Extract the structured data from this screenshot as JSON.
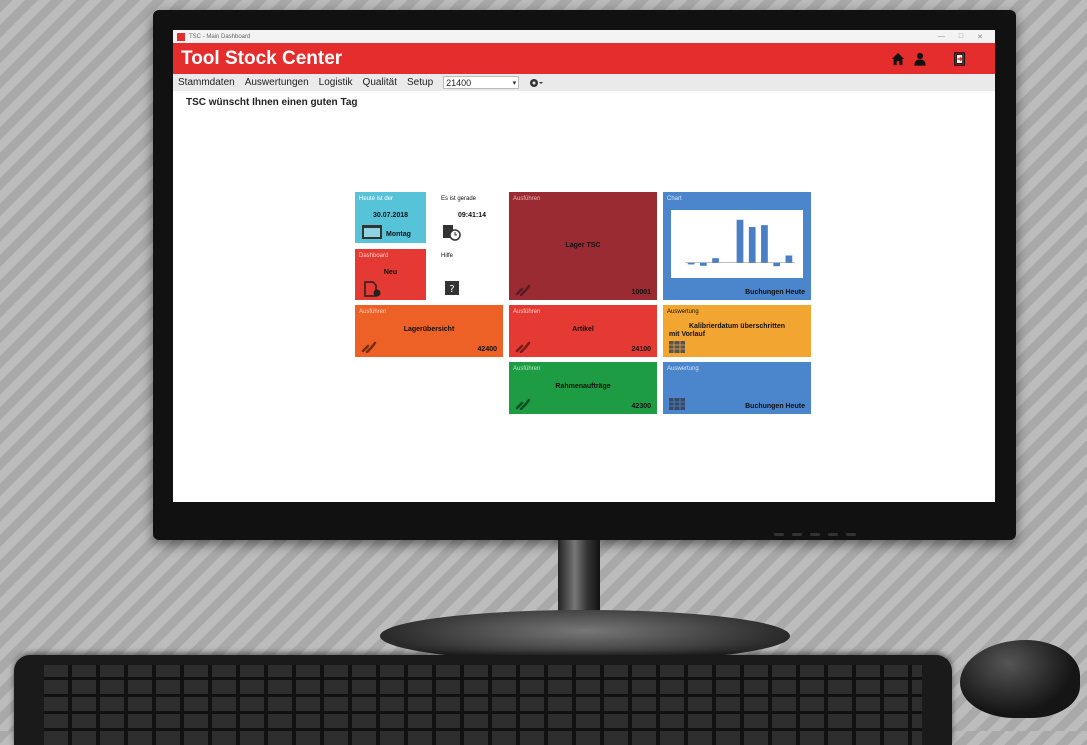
{
  "window": {
    "title": "TSC - Main Dashboard",
    "minimize": "—",
    "maximize": "□",
    "close": "✕"
  },
  "header": {
    "app_title": "Tool Stock Center"
  },
  "menu": {
    "items": [
      "Stammdaten",
      "Auswertungen",
      "Logistik",
      "Qualität",
      "Setup"
    ],
    "combo_value": "21400",
    "combo_arrow": "▾"
  },
  "greeting": "TSC wünscht Ihnen einen guten Tag",
  "tiles": {
    "date": {
      "caption": "Heute ist der",
      "date": "30.07.2018",
      "weekday": "Montag"
    },
    "time": {
      "caption": "Es ist gerade",
      "time": "09:41:14"
    },
    "dashboard": {
      "caption": "Dashboard",
      "main": "Neu"
    },
    "help": {
      "caption": "Hilfe"
    },
    "lager": {
      "caption": "Ausführen",
      "main": "Lager TSC",
      "number": "10001"
    },
    "chart": {
      "caption": "Chart",
      "footer": "Buchungen Heute"
    },
    "lageruebersicht": {
      "caption": "Ausführen",
      "main": "Lagerübersicht",
      "number": "42400"
    },
    "artikel": {
      "caption": "Ausführen",
      "main": "Artikel",
      "number": "24100"
    },
    "kalibrier": {
      "caption": "Auswertung",
      "main_line1": "Kalibrierdatum überschritten",
      "main_line2": "mit Vorlauf"
    },
    "rahmen": {
      "caption": "Ausführen",
      "main": "Rahmenaufträge",
      "number": "42300"
    },
    "buchungen": {
      "caption": "Auswertung",
      "footer": "Buchungen Heute"
    }
  },
  "chart_data": {
    "type": "bar",
    "values": [
      -4,
      -7,
      10,
      0,
      96,
      80,
      84,
      -8,
      16
    ],
    "ylim": [
      -12,
      100
    ]
  },
  "colors": {
    "header_red": "#e52d2d",
    "tile_cyan": "#57c3d9",
    "tile_red": "#e43a33",
    "tile_darkred": "#9b2b33",
    "tile_blue": "#4b86cc",
    "tile_orange": "#ed6127",
    "tile_amber": "#f2a531",
    "tile_green": "#1e9c44"
  }
}
